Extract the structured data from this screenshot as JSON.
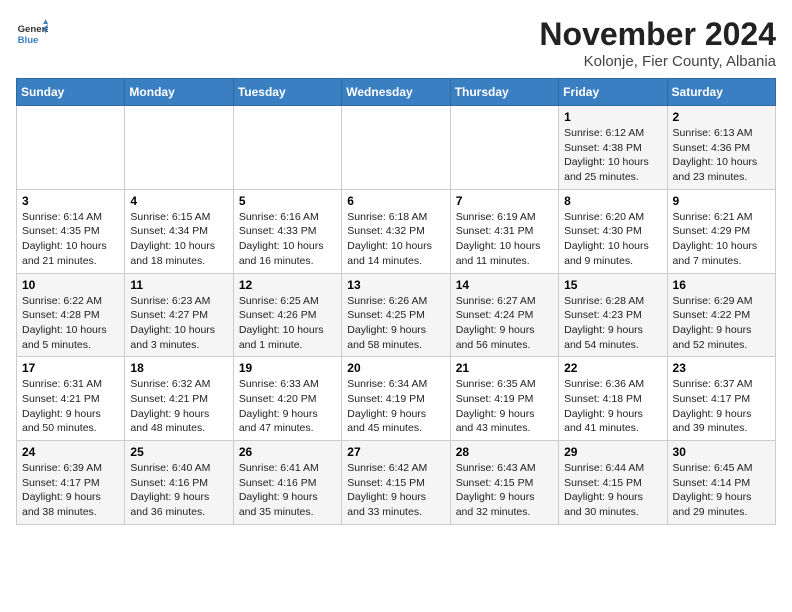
{
  "logo": {
    "general": "General",
    "blue": "Blue"
  },
  "header": {
    "month": "November 2024",
    "location": "Kolonje, Fier County, Albania"
  },
  "weekdays": [
    "Sunday",
    "Monday",
    "Tuesday",
    "Wednesday",
    "Thursday",
    "Friday",
    "Saturday"
  ],
  "weeks": [
    [
      {
        "day": null
      },
      {
        "day": null
      },
      {
        "day": null
      },
      {
        "day": null
      },
      {
        "day": null
      },
      {
        "day": 1,
        "sunrise": "6:12 AM",
        "sunset": "4:38 PM",
        "daylight": "10 hours and 25 minutes."
      },
      {
        "day": 2,
        "sunrise": "6:13 AM",
        "sunset": "4:36 PM",
        "daylight": "10 hours and 23 minutes."
      }
    ],
    [
      {
        "day": 3,
        "sunrise": "6:14 AM",
        "sunset": "4:35 PM",
        "daylight": "10 hours and 21 minutes."
      },
      {
        "day": 4,
        "sunrise": "6:15 AM",
        "sunset": "4:34 PM",
        "daylight": "10 hours and 18 minutes."
      },
      {
        "day": 5,
        "sunrise": "6:16 AM",
        "sunset": "4:33 PM",
        "daylight": "10 hours and 16 minutes."
      },
      {
        "day": 6,
        "sunrise": "6:18 AM",
        "sunset": "4:32 PM",
        "daylight": "10 hours and 14 minutes."
      },
      {
        "day": 7,
        "sunrise": "6:19 AM",
        "sunset": "4:31 PM",
        "daylight": "10 hours and 11 minutes."
      },
      {
        "day": 8,
        "sunrise": "6:20 AM",
        "sunset": "4:30 PM",
        "daylight": "10 hours and 9 minutes."
      },
      {
        "day": 9,
        "sunrise": "6:21 AM",
        "sunset": "4:29 PM",
        "daylight": "10 hours and 7 minutes."
      }
    ],
    [
      {
        "day": 10,
        "sunrise": "6:22 AM",
        "sunset": "4:28 PM",
        "daylight": "10 hours and 5 minutes."
      },
      {
        "day": 11,
        "sunrise": "6:23 AM",
        "sunset": "4:27 PM",
        "daylight": "10 hours and 3 minutes."
      },
      {
        "day": 12,
        "sunrise": "6:25 AM",
        "sunset": "4:26 PM",
        "daylight": "10 hours and 1 minute."
      },
      {
        "day": 13,
        "sunrise": "6:26 AM",
        "sunset": "4:25 PM",
        "daylight": "9 hours and 58 minutes."
      },
      {
        "day": 14,
        "sunrise": "6:27 AM",
        "sunset": "4:24 PM",
        "daylight": "9 hours and 56 minutes."
      },
      {
        "day": 15,
        "sunrise": "6:28 AM",
        "sunset": "4:23 PM",
        "daylight": "9 hours and 54 minutes."
      },
      {
        "day": 16,
        "sunrise": "6:29 AM",
        "sunset": "4:22 PM",
        "daylight": "9 hours and 52 minutes."
      }
    ],
    [
      {
        "day": 17,
        "sunrise": "6:31 AM",
        "sunset": "4:21 PM",
        "daylight": "9 hours and 50 minutes."
      },
      {
        "day": 18,
        "sunrise": "6:32 AM",
        "sunset": "4:21 PM",
        "daylight": "9 hours and 48 minutes."
      },
      {
        "day": 19,
        "sunrise": "6:33 AM",
        "sunset": "4:20 PM",
        "daylight": "9 hours and 47 minutes."
      },
      {
        "day": 20,
        "sunrise": "6:34 AM",
        "sunset": "4:19 PM",
        "daylight": "9 hours and 45 minutes."
      },
      {
        "day": 21,
        "sunrise": "6:35 AM",
        "sunset": "4:19 PM",
        "daylight": "9 hours and 43 minutes."
      },
      {
        "day": 22,
        "sunrise": "6:36 AM",
        "sunset": "4:18 PM",
        "daylight": "9 hours and 41 minutes."
      },
      {
        "day": 23,
        "sunrise": "6:37 AM",
        "sunset": "4:17 PM",
        "daylight": "9 hours and 39 minutes."
      }
    ],
    [
      {
        "day": 24,
        "sunrise": "6:39 AM",
        "sunset": "4:17 PM",
        "daylight": "9 hours and 38 minutes."
      },
      {
        "day": 25,
        "sunrise": "6:40 AM",
        "sunset": "4:16 PM",
        "daylight": "9 hours and 36 minutes."
      },
      {
        "day": 26,
        "sunrise": "6:41 AM",
        "sunset": "4:16 PM",
        "daylight": "9 hours and 35 minutes."
      },
      {
        "day": 27,
        "sunrise": "6:42 AM",
        "sunset": "4:15 PM",
        "daylight": "9 hours and 33 minutes."
      },
      {
        "day": 28,
        "sunrise": "6:43 AM",
        "sunset": "4:15 PM",
        "daylight": "9 hours and 32 minutes."
      },
      {
        "day": 29,
        "sunrise": "6:44 AM",
        "sunset": "4:15 PM",
        "daylight": "9 hours and 30 minutes."
      },
      {
        "day": 30,
        "sunrise": "6:45 AM",
        "sunset": "4:14 PM",
        "daylight": "9 hours and 29 minutes."
      }
    ]
  ],
  "labels": {
    "sunrise": "Sunrise:",
    "sunset": "Sunset:",
    "daylight": "Daylight:"
  }
}
